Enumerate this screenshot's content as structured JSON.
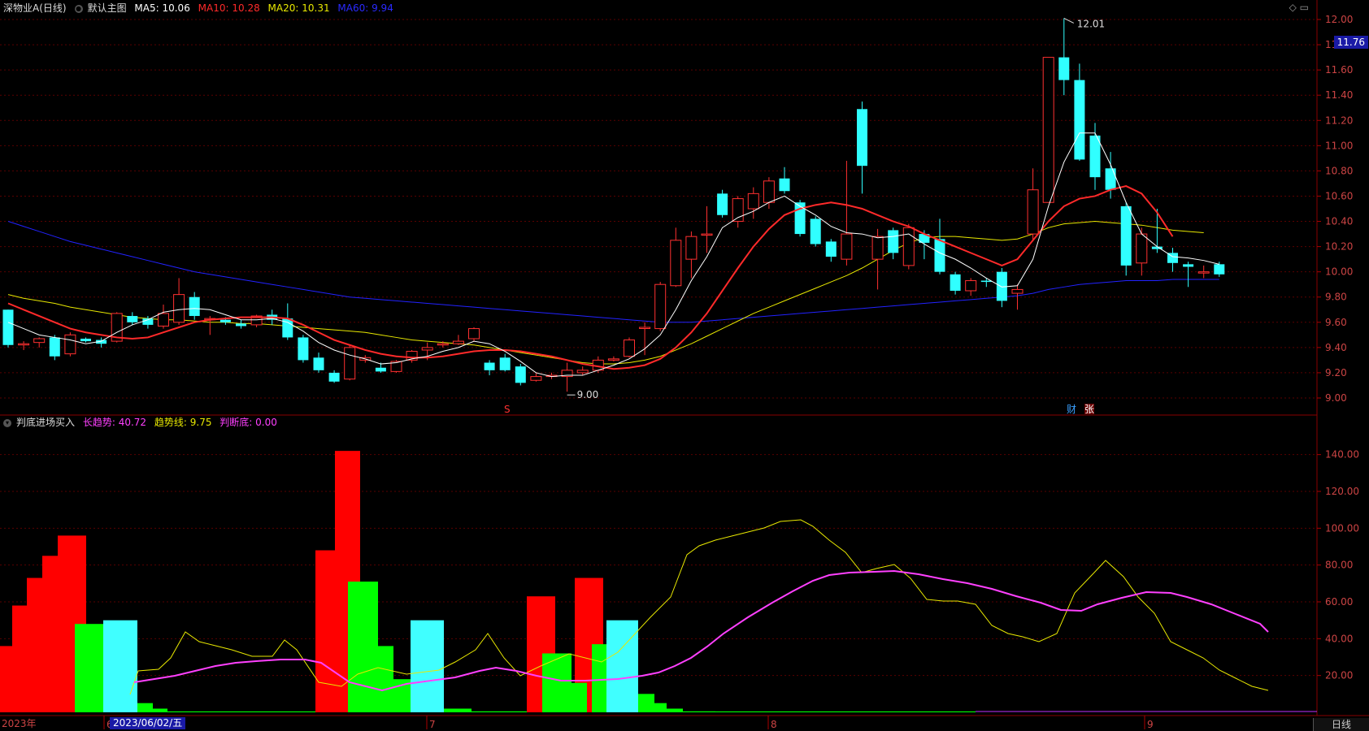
{
  "header": {
    "symbol": "深物业A(日线)",
    "mode_label": "默认主图",
    "ma5": "MA5: 10.06",
    "ma10": "MA10: 10.28",
    "ma20": "MA20: 10.31",
    "ma60": "MA60: 9.94",
    "colors": {
      "ma5": "#ffffff",
      "ma10": "#ff2a2a",
      "ma20": "#e8e800",
      "ma60": "#2222ff"
    }
  },
  "indicator_header": {
    "name": "判底进场买入",
    "long_trend": "长趋势: 40.72",
    "trend_line": "趋势线: 9.75",
    "bottom": "判断底: 0.00"
  },
  "price_axis": {
    "ticks": [
      "12.00",
      "11.80",
      "11.60",
      "11.40",
      "11.20",
      "11.00",
      "10.80",
      "10.60",
      "10.40",
      "10.20",
      "10.00",
      "9.80",
      "9.60",
      "9.40",
      "9.20",
      "9.00"
    ],
    "current": "11.76"
  },
  "indicator_axis": {
    "ticks": [
      "140.00",
      "120.00",
      "100.00",
      "80.00",
      "60.00",
      "40.00",
      "20.00"
    ]
  },
  "annotations": {
    "high": "12.01",
    "low": "9.00",
    "marker_s": "S",
    "marker_cai": "财",
    "marker_zhang": "张"
  },
  "time_axis": {
    "year": "2023年",
    "m6": "6",
    "m7": "7",
    "m8": "8",
    "m9": "9",
    "cursor_date": "2023/06/02/五",
    "period": "日线"
  },
  "chart_data": {
    "type": "candlestick",
    "title": "深物业A(日线)",
    "ylim": [
      8.9,
      12.1
    ],
    "candles": [
      [
        9.7,
        9.42,
        9.7,
        9.4
      ],
      [
        9.43,
        9.43,
        9.45,
        9.38
      ],
      [
        9.44,
        9.47,
        9.48,
        9.4
      ],
      [
        9.48,
        9.33,
        9.5,
        9.3
      ],
      [
        9.35,
        9.5,
        9.52,
        9.33
      ],
      [
        9.47,
        9.45,
        9.48,
        9.44
      ],
      [
        9.46,
        9.43,
        9.48,
        9.4
      ],
      [
        9.45,
        9.67,
        9.68,
        9.44
      ],
      [
        9.65,
        9.6,
        9.68,
        9.58
      ],
      [
        9.63,
        9.58,
        9.65,
        9.55
      ],
      [
        9.57,
        9.67,
        9.74,
        9.55
      ],
      [
        9.6,
        9.82,
        9.95,
        9.58
      ],
      [
        9.8,
        9.65,
        9.84,
        9.62
      ],
      [
        9.63,
        9.63,
        9.65,
        9.5
      ],
      [
        9.62,
        9.6,
        9.64,
        9.58
      ],
      [
        9.59,
        9.57,
        9.62,
        9.55
      ],
      [
        9.58,
        9.65,
        9.66,
        9.56
      ],
      [
        9.66,
        9.62,
        9.7,
        9.58
      ],
      [
        9.63,
        9.48,
        9.75,
        9.46
      ],
      [
        9.48,
        9.3,
        9.5,
        9.28
      ],
      [
        9.32,
        9.22,
        9.36,
        9.2
      ],
      [
        9.2,
        9.13,
        9.22,
        9.12
      ],
      [
        9.15,
        9.4,
        9.42,
        9.14
      ],
      [
        9.3,
        9.32,
        9.34,
        9.28
      ],
      [
        9.24,
        9.21,
        9.28,
        9.2
      ],
      [
        9.21,
        9.29,
        9.3,
        9.2
      ],
      [
        9.3,
        9.37,
        9.38,
        9.28
      ],
      [
        9.38,
        9.4,
        9.44,
        9.3
      ],
      [
        9.42,
        9.43,
        9.45,
        9.4
      ],
      [
        9.43,
        9.45,
        9.5,
        9.42
      ],
      [
        9.47,
        9.55,
        9.56,
        9.45
      ],
      [
        9.28,
        9.22,
        9.3,
        9.18
      ],
      [
        9.32,
        9.22,
        9.35,
        9.21
      ],
      [
        9.25,
        9.12,
        9.27,
        9.1
      ],
      [
        9.14,
        9.17,
        9.2,
        9.13
      ],
      [
        9.17,
        9.18,
        9.2,
        9.15
      ],
      [
        9.17,
        9.22,
        9.28,
        9.05
      ],
      [
        9.2,
        9.22,
        9.25,
        9.18
      ],
      [
        9.22,
        9.3,
        9.33,
        9.2
      ],
      [
        9.3,
        9.31,
        9.33,
        9.29
      ],
      [
        9.33,
        9.46,
        9.48,
        9.32
      ],
      [
        9.56,
        9.56,
        9.6,
        9.34
      ],
      [
        9.55,
        9.9,
        9.92,
        9.53
      ],
      [
        9.89,
        10.25,
        10.35,
        9.88
      ],
      [
        10.1,
        10.28,
        10.32,
        9.95
      ],
      [
        10.3,
        10.3,
        10.52,
        10.15
      ],
      [
        10.62,
        10.45,
        10.65,
        10.43
      ],
      [
        10.4,
        10.58,
        10.6,
        10.35
      ],
      [
        10.5,
        10.62,
        10.67,
        10.42
      ],
      [
        10.55,
        10.72,
        10.75,
        10.5
      ],
      [
        10.74,
        10.64,
        10.83,
        10.62
      ],
      [
        10.55,
        10.3,
        10.57,
        10.28
      ],
      [
        10.42,
        10.22,
        10.44,
        10.2
      ],
      [
        10.24,
        10.12,
        10.26,
        10.08
      ],
      [
        10.1,
        10.3,
        10.88,
        10.05
      ],
      [
        11.29,
        10.84,
        11.35,
        10.62
      ],
      [
        10.1,
        10.28,
        10.34,
        9.86
      ],
      [
        10.33,
        10.15,
        10.35,
        10.1
      ],
      [
        10.05,
        10.35,
        10.38,
        10.02
      ],
      [
        10.3,
        10.23,
        10.33,
        10.1
      ],
      [
        10.26,
        10.0,
        10.42,
        9.98
      ],
      [
        9.98,
        9.85,
        10.0,
        9.82
      ],
      [
        9.85,
        9.93,
        9.95,
        9.81
      ],
      [
        9.93,
        9.92,
        9.95,
        9.88
      ],
      [
        10.0,
        9.77,
        10.03,
        9.72
      ],
      [
        9.83,
        9.86,
        9.9,
        9.7
      ],
      [
        10.3,
        10.65,
        10.82,
        10.25
      ],
      [
        10.55,
        11.7,
        11.7,
        10.55
      ],
      [
        11.7,
        11.52,
        12.01,
        11.4
      ],
      [
        11.52,
        10.89,
        11.65,
        10.88
      ],
      [
        11.08,
        10.75,
        11.18,
        10.65
      ],
      [
        10.82,
        10.65,
        10.95,
        10.58
      ],
      [
        10.52,
        10.05,
        10.55,
        9.97
      ],
      [
        10.07,
        10.3,
        10.35,
        9.97
      ],
      [
        10.2,
        10.18,
        10.5,
        10.15
      ],
      [
        10.15,
        10.07,
        10.19,
        10.0
      ],
      [
        10.06,
        10.04,
        10.08,
        9.88
      ],
      [
        10.0,
        10.0,
        10.05,
        9.95
      ],
      [
        10.06,
        9.98,
        10.08,
        9.96
      ]
    ],
    "ma5": [
      9.6,
      9.55,
      9.5,
      9.48,
      9.46,
      9.43,
      9.45,
      9.52,
      9.58,
      9.62,
      9.68,
      9.7,
      9.71,
      9.7,
      9.66,
      9.62,
      9.62,
      9.63,
      9.6,
      9.53,
      9.44,
      9.38,
      9.34,
      9.31,
      9.27,
      9.28,
      9.31,
      9.33,
      9.37,
      9.4,
      9.45,
      9.43,
      9.37,
      9.29,
      9.2,
      9.17,
      9.18,
      9.18,
      9.22,
      9.26,
      9.31,
      9.39,
      9.5,
      9.7,
      9.93,
      10.12,
      10.35,
      10.43,
      10.48,
      10.55,
      10.6,
      10.52,
      10.45,
      10.36,
      10.31,
      10.3,
      10.27,
      10.28,
      10.3,
      10.22,
      10.15,
      10.1,
      10.03,
      9.95,
      9.88,
      9.89,
      10.1,
      10.52,
      10.87,
      11.1,
      11.1,
      10.85,
      10.55,
      10.3,
      10.2,
      10.12,
      10.11,
      10.09,
      10.06
    ],
    "ma10": [
      9.75,
      9.7,
      9.65,
      9.6,
      9.55,
      9.52,
      9.5,
      9.48,
      9.47,
      9.48,
      9.52,
      9.56,
      9.6,
      9.62,
      9.63,
      9.64,
      9.64,
      9.64,
      9.63,
      9.58,
      9.52,
      9.46,
      9.42,
      9.38,
      9.35,
      9.33,
      9.32,
      9.32,
      9.33,
      9.35,
      9.37,
      9.38,
      9.38,
      9.37,
      9.35,
      9.33,
      9.3,
      9.27,
      9.25,
      9.23,
      9.24,
      9.26,
      9.31,
      9.4,
      9.52,
      9.67,
      9.85,
      10.03,
      10.2,
      10.34,
      10.45,
      10.5,
      10.53,
      10.55,
      10.53,
      10.5,
      10.45,
      10.4,
      10.36,
      10.3,
      10.25,
      10.2,
      10.15,
      10.1,
      10.05,
      10.1,
      10.25,
      10.4,
      10.52,
      10.58,
      10.6,
      10.65,
      10.68,
      10.62,
      10.47,
      10.28
    ]
  }
}
